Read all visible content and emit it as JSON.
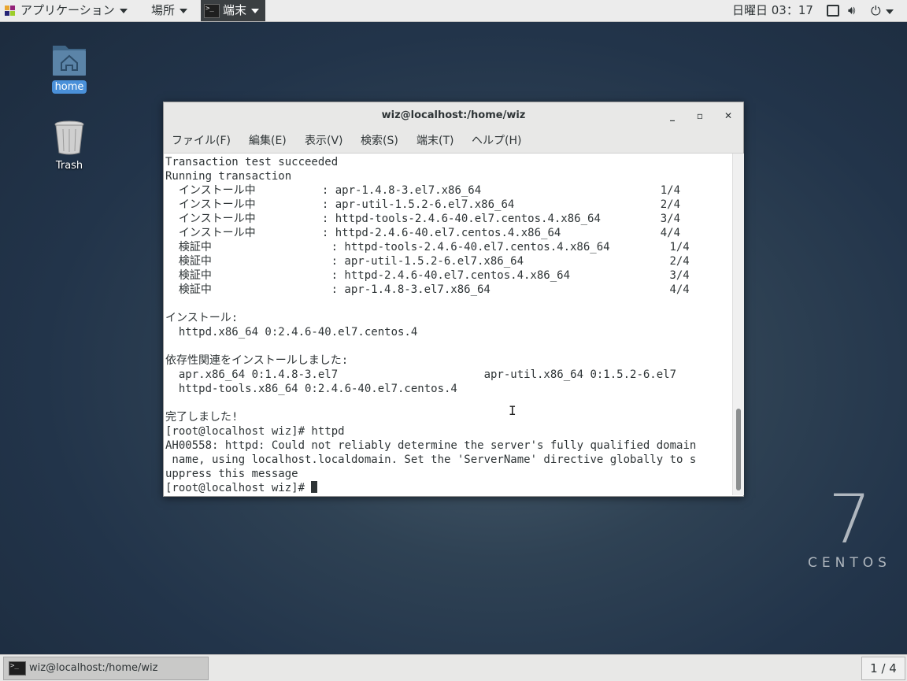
{
  "topbar": {
    "applications_label": "アプリケーション",
    "places_label": "場所",
    "terminal_label": "端末",
    "clock": "日曜日 03：17"
  },
  "desktop": {
    "home_label": "home",
    "trash_label": "Trash"
  },
  "window": {
    "title": "wiz@localhost:/home/wiz",
    "minimize": "_",
    "maximize": "▫",
    "close": "✕",
    "menu": [
      "ファイル(F)",
      "編集(E)",
      "表示(V)",
      "検索(S)",
      "端末(T)",
      "ヘルプ(H)"
    ]
  },
  "terminal": {
    "lines": [
      "Transaction test succeeded",
      "Running transaction",
      "  インストール中          : apr-1.4.8-3.el7.x86_64                           1/4",
      "  インストール中          : apr-util-1.5.2-6.el7.x86_64                      2/4",
      "  インストール中          : httpd-tools-2.4.6-40.el7.centos.4.x86_64         3/4",
      "  インストール中          : httpd-2.4.6-40.el7.centos.4.x86_64               4/4",
      "  検証中                  : httpd-tools-2.4.6-40.el7.centos.4.x86_64         1/4",
      "  検証中                  : apr-util-1.5.2-6.el7.x86_64                      2/4",
      "  検証中                  : httpd-2.4.6-40.el7.centos.4.x86_64               3/4",
      "  検証中                  : apr-1.4.8-3.el7.x86_64                           4/4",
      "",
      "インストール:",
      "  httpd.x86_64 0:2.4.6-40.el7.centos.4",
      "",
      "依存性関連をインストールしました:",
      "  apr.x86_64 0:1.4.8-3.el7                      apr-util.x86_64 0:1.5.2-6.el7",
      "  httpd-tools.x86_64 0:2.4.6-40.el7.centos.4",
      "",
      "完了しました!",
      "[root@localhost wiz]# httpd",
      "AH00558: httpd: Could not reliably determine the server's fully qualified domain",
      " name, using localhost.localdomain. Set the 'ServerName' directive globally to s",
      "uppress this message",
      "[root@localhost wiz]# "
    ]
  },
  "branding": {
    "number": "7",
    "word": "CENTOS"
  },
  "bottombar": {
    "task_label": "wiz@localhost:/home/wiz",
    "workspace": "1 / 4"
  },
  "colors": {
    "accent": "#4a90d9",
    "terminal_fg": "#2e3436"
  }
}
